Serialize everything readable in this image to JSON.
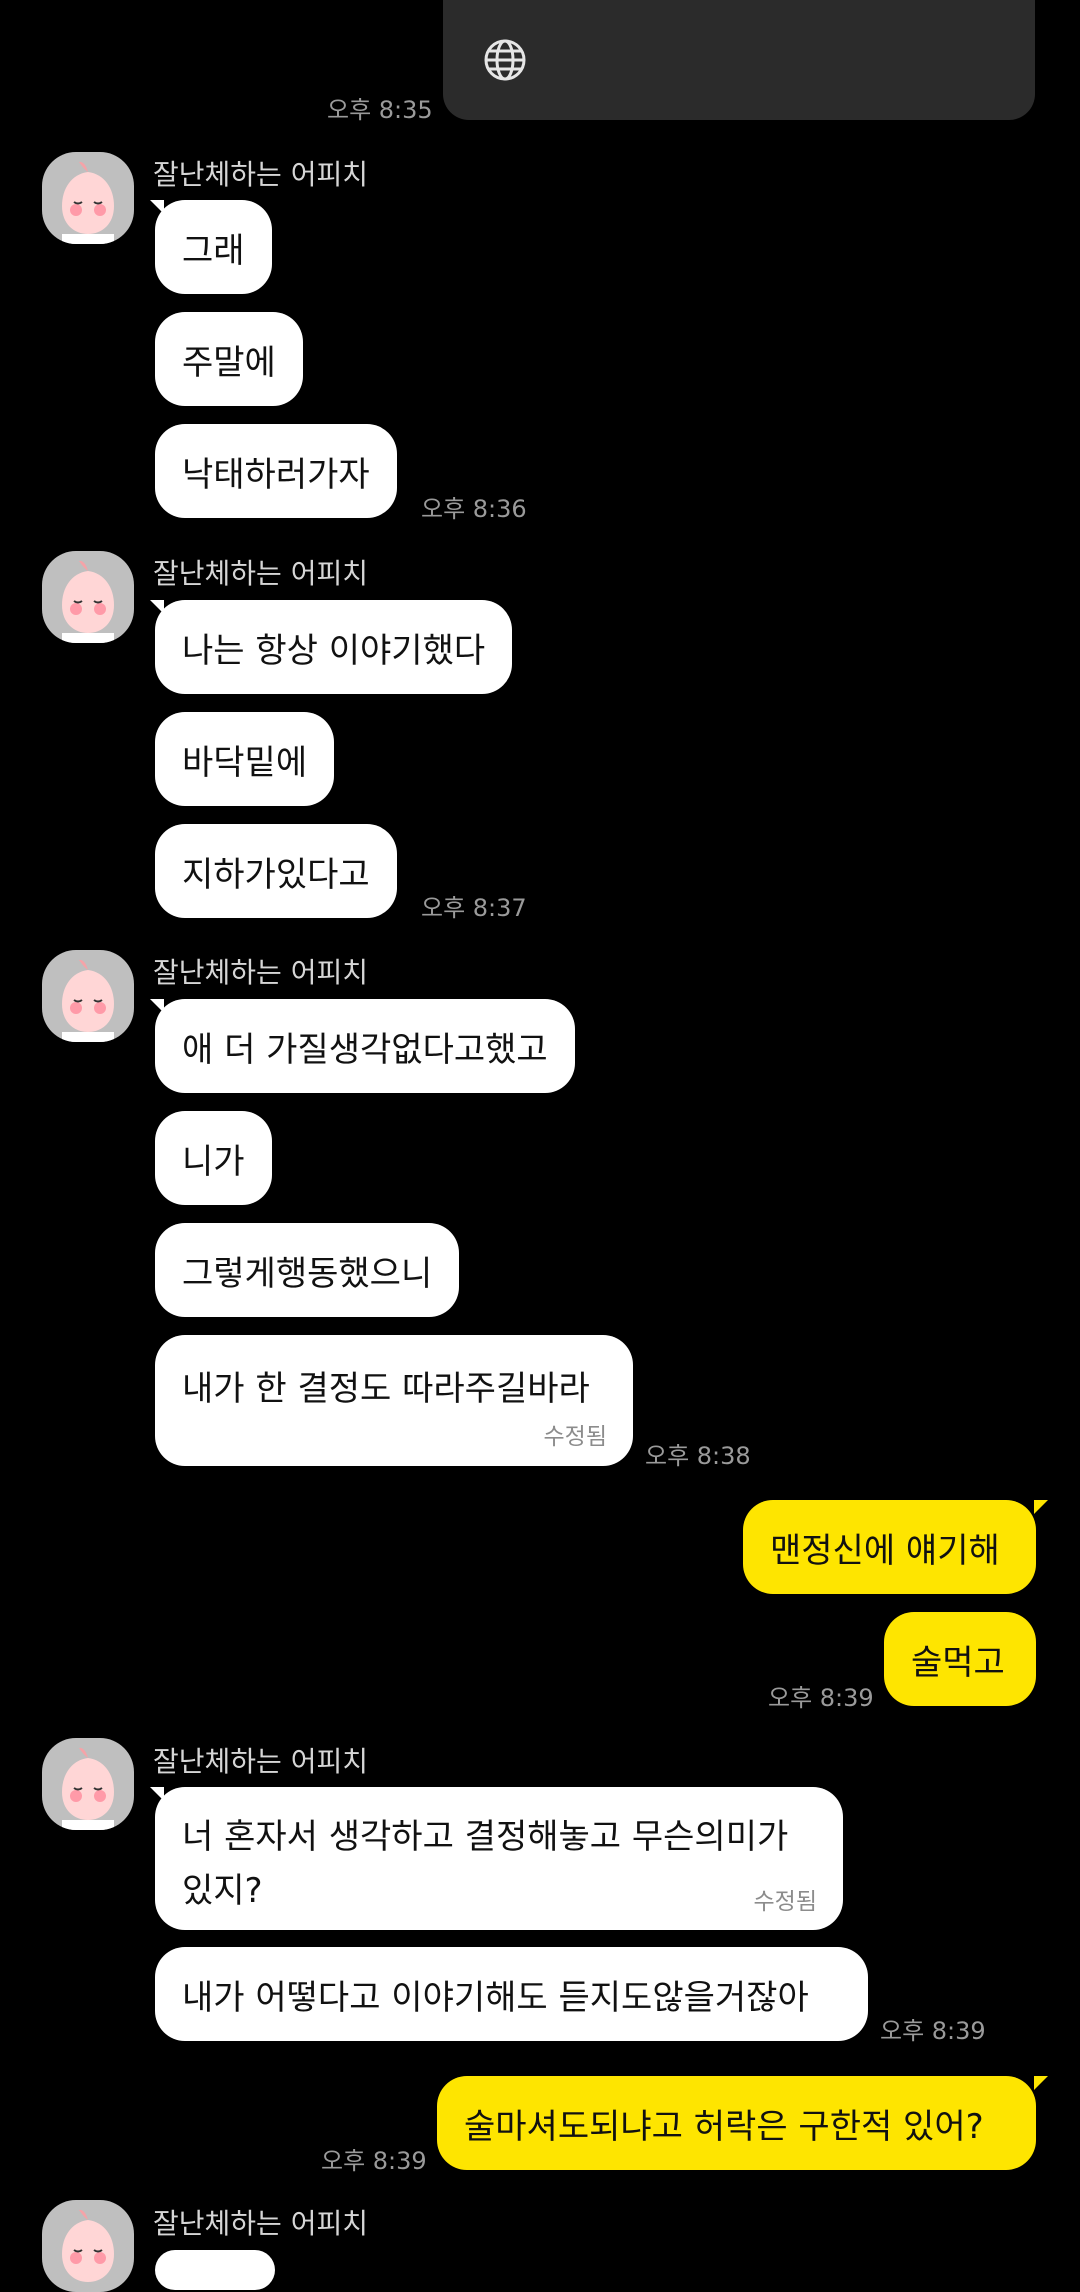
{
  "top_card": {
    "icon": "globe-icon",
    "time": "오후 8:35"
  },
  "sender": "잘난체하는 어피치",
  "groups": [
    {
      "messages": [
        "그래",
        "주말에",
        "낙태하러가자"
      ],
      "time": "오후 8:36"
    },
    {
      "messages": [
        "나는 항상 이야기했다",
        "바닥밑에",
        "지하가있다고"
      ],
      "time": "오후 8:37"
    },
    {
      "messages": [
        "애 더 가질생각없다고했고",
        "니가",
        "그렇게행동했으니",
        "내가 한 결정도 따라주길바라"
      ],
      "edited": "수정됨",
      "time": "오후 8:38"
    }
  ],
  "my_messages_1": {
    "messages": [
      "맨정신에 얘기해",
      "술먹고"
    ],
    "time": "오후 8:39"
  },
  "group4": {
    "msg1_line1": "너 혼자서 생각하고 결정해놓고 무슨의미가",
    "msg1_line2": "있지?",
    "edited": "수정됨",
    "msg2": "내가 어떻다고 이야기해도 듣지도않을거잖아",
    "time": "오후 8:39"
  },
  "my_messages_2": {
    "message": "술마셔도되냐고 허락은 구한적 있어?",
    "time": "오후 8:39"
  },
  "colors": {
    "background": "#000000",
    "incoming_bubble": "#ffffff",
    "outgoing_bubble": "#fee500"
  }
}
